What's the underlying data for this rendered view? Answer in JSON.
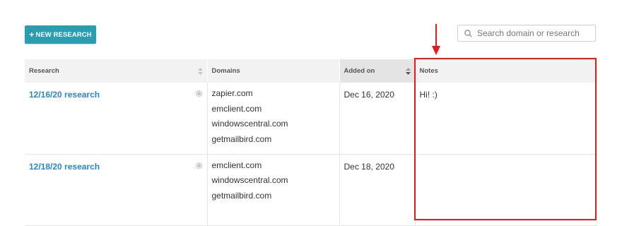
{
  "toolbar": {
    "new_button_plus": "+",
    "new_button_label": "NEW RESEARCH"
  },
  "search": {
    "placeholder": "Search domain or research",
    "icon": "search-icon"
  },
  "table": {
    "headers": {
      "research": "Research",
      "domains": "Domains",
      "added_on": "Added on",
      "notes": "Notes"
    },
    "rows": [
      {
        "research": "12/16/20 research",
        "domains": [
          "zapier.com",
          "emclient.com",
          "windowscentral.com",
          "getmailbird.com"
        ],
        "added_on": "Dec 16, 2020",
        "notes": "Hi! :)"
      },
      {
        "research": "12/18/20 research",
        "domains": [
          "emclient.com",
          "windowscentral.com",
          "getmailbird.com"
        ],
        "added_on": "Dec 18, 2020",
        "notes": ""
      }
    ]
  },
  "colors": {
    "accent": "#2a9db1",
    "link": "#2a86c8",
    "annotation": "#e31b1b"
  }
}
